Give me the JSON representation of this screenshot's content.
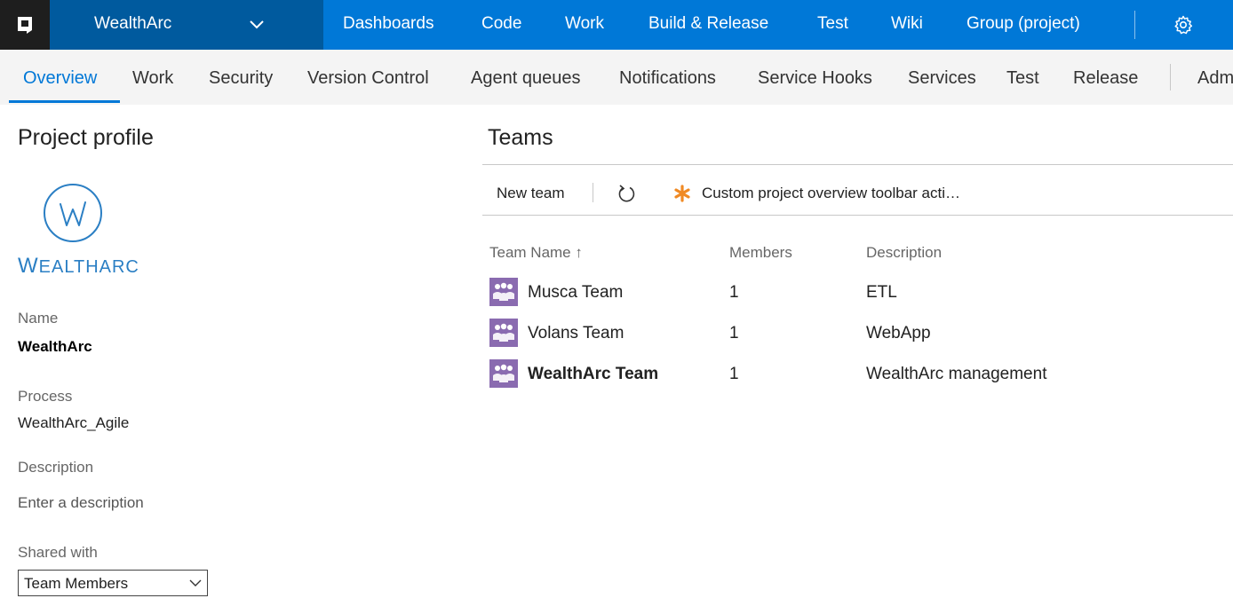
{
  "top_nav": {
    "project": "WealthArc",
    "items": [
      "Dashboards",
      "Code",
      "Work",
      "Build & Release",
      "Test",
      "Wiki",
      "Group (project)"
    ],
    "colors": {
      "bar": "#0078d7",
      "project_box": "#005a9e",
      "logo_box": "#1e1e1e"
    }
  },
  "sub_nav": {
    "items": [
      "Overview",
      "Work",
      "Security",
      "Version Control",
      "Agent queues",
      "Notifications",
      "Service Hooks",
      "Services",
      "Test",
      "Release"
    ],
    "admin_partial": "Adm",
    "active": "Overview"
  },
  "profile": {
    "title": "Project profile",
    "brand_first": "W",
    "brand_rest": "EALTHARC",
    "name_label": "Name",
    "name_value": "WealthArc",
    "process_label": "Process",
    "process_value": "WealthArc_Agile",
    "description_label": "Description",
    "description_value": "Enter a description",
    "shared_label": "Shared with",
    "shared_value": "Team Members"
  },
  "teams": {
    "title": "Teams",
    "toolbar": {
      "new_team": "New team",
      "custom_action": "Custom project overview toolbar acti…"
    },
    "columns": [
      "Team Name ↑",
      "Members",
      "Description"
    ],
    "rows": [
      {
        "name": "Musca Team",
        "members": "1",
        "description": "ETL",
        "bold": false
      },
      {
        "name": "Volans Team",
        "members": "1",
        "description": "WebApp",
        "bold": false
      },
      {
        "name": "WealthArc Team",
        "members": "1",
        "description": "WealthArc management",
        "bold": true
      }
    ],
    "icon_color": "#8a6bb0"
  }
}
